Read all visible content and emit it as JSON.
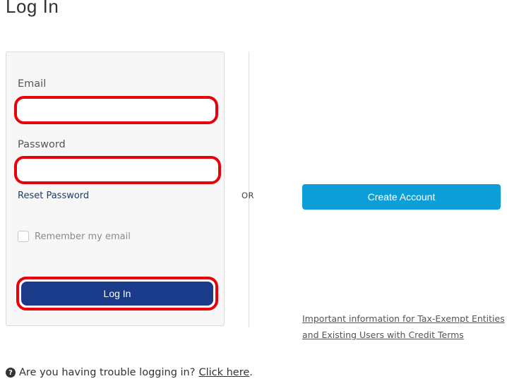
{
  "page": {
    "title": "Log In"
  },
  "login": {
    "email_label": "Email",
    "email_value": "",
    "password_label": "Password",
    "password_value": "",
    "reset_link": "Reset Password",
    "remember_label": "Remember my email",
    "remember_checked": false,
    "submit_label": "Log In"
  },
  "divider": {
    "or_label": "OR"
  },
  "signup": {
    "create_label": "Create Account",
    "tax_link_label": "Important information for Tax-Exempt Entities and Existing Users with Credit Terms"
  },
  "help": {
    "question_text": "Are you having trouble logging in?",
    "link_text": "Click here",
    "suffix": "."
  },
  "colors": {
    "primary_button": "#1a3a8a",
    "create_button": "#0c9ed6",
    "highlight_border": "#e8000b"
  }
}
